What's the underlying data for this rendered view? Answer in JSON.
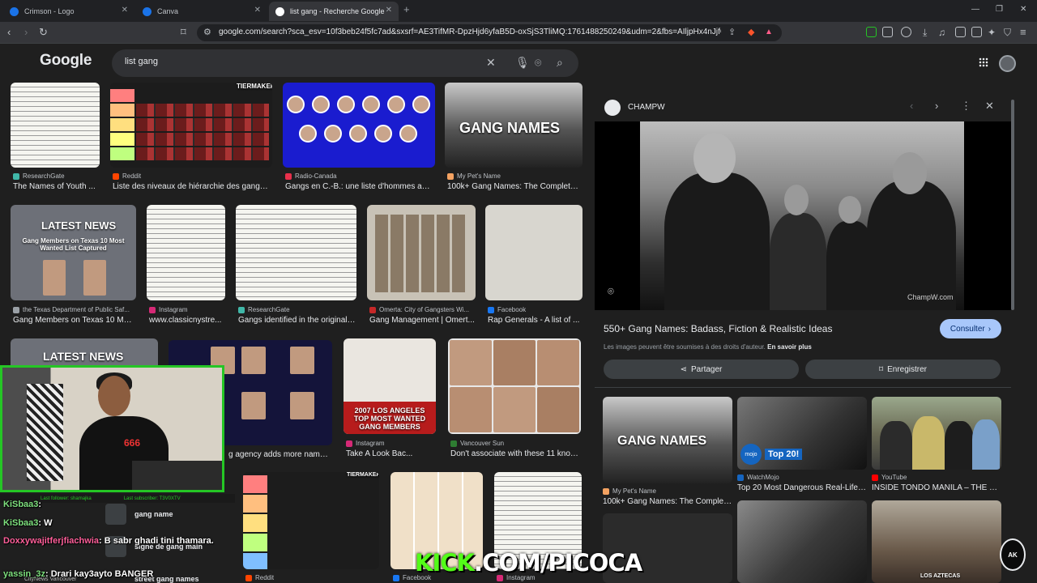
{
  "browser": {
    "tabs": [
      {
        "title": "Crimson - Logo",
        "favicon_color": "#1a73e8"
      },
      {
        "title": "Canva",
        "favicon_color": "#1a73e8"
      },
      {
        "title": "list gang - Recherche Google",
        "favicon_color": "#ffffff"
      }
    ],
    "url": "google.com/search?sca_esv=10f3beb24f5fc7ad&sxsrf=AE3TifMR-DpzHjd6yfaB5D-oxSjS3TliMQ:1761488250249&udm=2&fbs=AIljpHx4nJjfGojPVHhE..."
  },
  "google": {
    "logo": "Google",
    "query": "list gang"
  },
  "results": [
    {
      "source": "ResearchGate",
      "title": "The Names of Youth ..."
    },
    {
      "source": "Reddit",
      "title": "Liste des niveaux de hiérarchie des gangs ..."
    },
    {
      "source": "Radio-Canada",
      "title": "Gangs en C.-B.: une liste d'hommes au..."
    },
    {
      "source": "My Pet's Name",
      "title": "100k+ Gang Names: The Complete,..."
    },
    {
      "source": "the Texas Department of Public Saf...",
      "title": "Gang Members on Texas 10 Mo..."
    },
    {
      "source": "Instagram",
      "title": "www.classicnystre..."
    },
    {
      "source": "ResearchGate",
      "title": "Gangs identified in the original ..."
    },
    {
      "source": "Omerta: City of Gangsters Wi...",
      "title": "Gang Management | Omert..."
    },
    {
      "source": "Facebook",
      "title": "Rap Generals - A list of ..."
    },
    {
      "source": "",
      "title": "g agency adds more names ..."
    },
    {
      "source": "Instagram",
      "title": "Take A Look Bac..."
    },
    {
      "source": "Vancouver Sun",
      "title": "Don't associate with these 11 know..."
    },
    {
      "source": "Reddit",
      "title": ""
    },
    {
      "source": "Facebook",
      "title": ""
    },
    {
      "source": "Instagram",
      "title": ""
    }
  ],
  "thumb_text": {
    "tiermaker": "TIERMAKER",
    "gang_names": "GANG NAMES",
    "latest_news": "LATEST NEWS",
    "texas_headline": "Gang Members on Texas 10 Most Wanted List Captured",
    "la_wanted": "2007 LOS ANGELES TOP MOST WANTED GANG MEMBERS"
  },
  "panel": {
    "site": "CHAMPW",
    "title": "550+ Gang Names: Badass, Fiction & Realistic Ideas",
    "rights_text": "Les images peuvent être soumises à des droits d'auteur.",
    "rights_link": "En savoir plus",
    "visit_label": "Consulter",
    "share_label": "Partager",
    "save_label": "Enregistrer",
    "watermark": "ChampW.com",
    "related": [
      {
        "source": "My Pet's Name",
        "title": "100k+ Gang Names: The Complet..."
      },
      {
        "source": "WatchMojo",
        "title": "Top 20 Most Dangerous Real-Life ..."
      },
      {
        "source": "YouTube",
        "title": "INSIDE TONDO MANILA – THE M..."
      }
    ],
    "related_labels": {
      "top20": "Top 20!",
      "aztecas": "LOS AZTECAS",
      "mojo": "mojo"
    }
  },
  "stream": {
    "follower_bar": "Last follower: shamajka",
    "subscriber_bar": "Last subscriber: T3V0XTV",
    "shirt": "666",
    "chat": [
      {
        "user": "KiSbaa3",
        "message": ""
      },
      {
        "user": "KiSbaa3",
        "message": "W"
      },
      {
        "user": "Doxxywajitferjfiachwia",
        "message": "B sabr ghadi tini thamara."
      },
      {
        "user": "yassin_3z",
        "message": "Drari kay3ayto BANGER"
      }
    ],
    "kick_prefix": "KICK",
    "kick_suffix": ".COM/PICOCA",
    "corner_logo": "AK"
  },
  "suggestions": [
    "gang name",
    "signe de gang main",
    "street gang names"
  ],
  "covered_text": "CityNews Vancouver"
}
